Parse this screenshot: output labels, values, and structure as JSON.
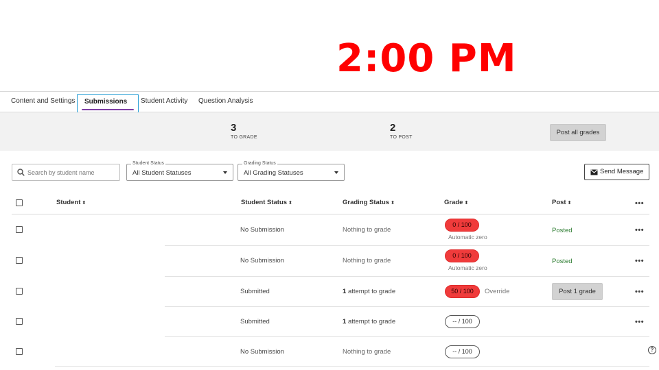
{
  "overlay_time": "2:00 PM",
  "tabs": [
    {
      "label": "Content and Settings"
    },
    {
      "label": "Submissions",
      "active": true
    },
    {
      "label": "Student Activity"
    },
    {
      "label": "Question Analysis"
    }
  ],
  "summary": {
    "to_grade_count": "3",
    "to_grade_label": "TO GRADE",
    "to_post_count": "2",
    "to_post_label": "TO POST",
    "post_all_label": "Post all grades"
  },
  "filters": {
    "search_placeholder": "Search by student name",
    "student_status": {
      "legend": "Student Status",
      "value": "All Student Statuses"
    },
    "grading_status": {
      "legend": "Grading Status",
      "value": "All Grading Statuses"
    },
    "send_message_label": "Send Message"
  },
  "columns": [
    "Student",
    "Student Status",
    "Grading Status",
    "Grade",
    "Post"
  ],
  "more_label": "•••",
  "rows": [
    {
      "student_status": "No Submission",
      "grading_count": "",
      "grading_status": "Nothing to grade",
      "grade": "0  / 100",
      "grade_style": "red",
      "grade_note": "Automatic zero",
      "post_label": "Posted",
      "post_type": "text"
    },
    {
      "student_status": "No Submission",
      "grading_count": "",
      "grading_status": "Nothing to grade",
      "grade": "0  / 100",
      "grade_style": "red",
      "grade_note": "Automatic zero",
      "post_label": "Posted",
      "post_type": "text"
    },
    {
      "student_status": "Submitted",
      "grading_count": "1",
      "grading_status": "attempt to grade",
      "grade": "50  / 100",
      "grade_style": "red",
      "grade_note": "Override",
      "post_label": "Post 1 grade",
      "post_type": "button"
    },
    {
      "student_status": "Submitted",
      "grading_count": "1",
      "grading_status": "attempt to grade",
      "grade": "--  / 100",
      "grade_style": "outline",
      "grade_note": "",
      "post_label": "",
      "post_type": "none"
    },
    {
      "student_status": "No Submission",
      "grading_count": "",
      "grading_status": "Nothing to grade",
      "grade": "--  / 100",
      "grade_style": "outline",
      "grade_note": "",
      "post_label": "",
      "post_type": "none"
    }
  ],
  "colors": {
    "grade_alert": "#f03b3b",
    "posted": "#2e7d32",
    "active_tab_underline": "#7e3fa5",
    "overlay": "#ff0000"
  }
}
